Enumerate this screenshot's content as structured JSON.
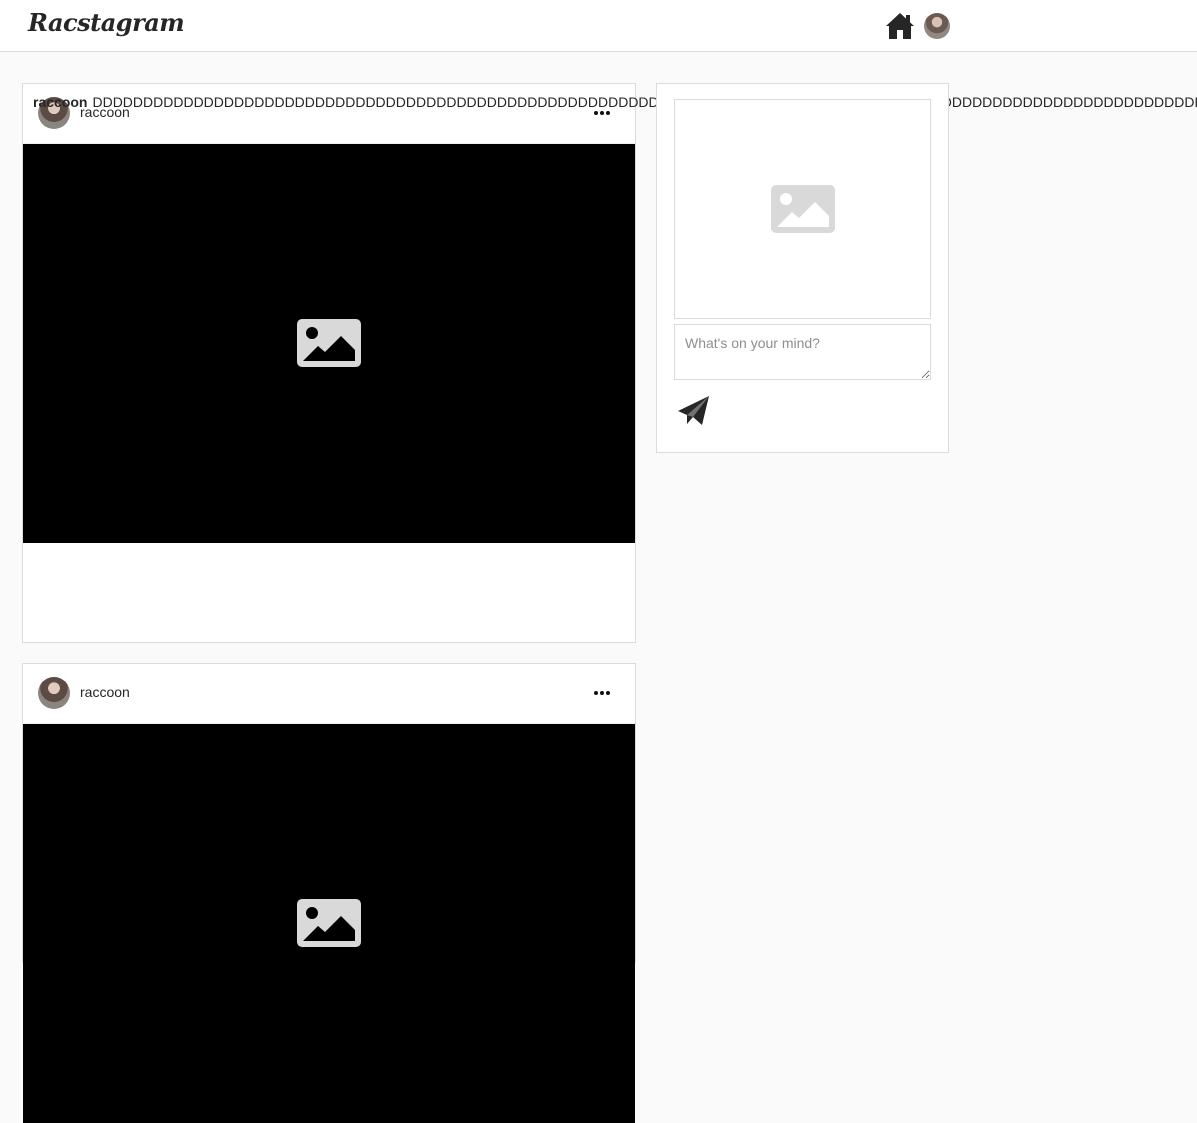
{
  "header": {
    "logo": "Racstagram",
    "icons": [
      "home-icon",
      "profile-avatar"
    ]
  },
  "feed": {
    "posts": [
      {
        "username": "raccoon",
        "caption_user": "raccoon",
        "caption_text": "DDDDDDDDDDDDDDDDDDDDDDDDDDDDDDDDDDDDDDDDDDDDDDDDDDDDDDDDDDDDDDDDDDDDDDDDDDDDDDDDDDDDDDDDDDDDDDDDDDDDDDDDDDDDDDDDDD"
      },
      {
        "username": "raccoon"
      }
    ]
  },
  "composer": {
    "placeholder": "What's on your mind?",
    "icons": [
      "image-placeholder-icon",
      "send-icon"
    ]
  },
  "colors": {
    "background": "#fafafa",
    "border": "#dbdbdb",
    "media_background": "#000000",
    "placeholder_icon": "#d9d9d9"
  }
}
